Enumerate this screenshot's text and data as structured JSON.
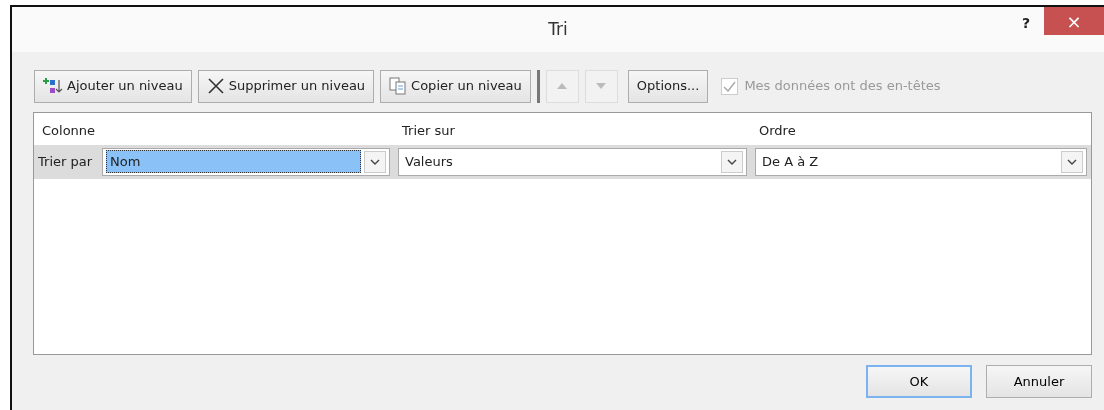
{
  "window": {
    "title": "Tri",
    "help": "?",
    "close": "×"
  },
  "toolbar": {
    "buttons": [
      {
        "kind": "add",
        "label": "Ajouter un niveau"
      },
      {
        "kind": "delete",
        "label": "Supprimer un niveau"
      },
      {
        "kind": "copy",
        "label": "Copier un niveau"
      }
    ],
    "move_up": {
      "disabled": true
    },
    "move_down": {
      "disabled": true
    },
    "options": "Options...",
    "headers_checkbox": {
      "label": "Mes données ont des en-têtes",
      "checked": true,
      "disabled": true
    }
  },
  "table": {
    "columns": [
      "Colonne",
      "Trier sur",
      "Ordre"
    ],
    "rows": [
      {
        "label": "Trier par",
        "selected": true,
        "column": {
          "value": "Nom",
          "highlighted": true
        },
        "sort_on": "Valeurs",
        "order": "De A à Z"
      }
    ]
  },
  "footer": {
    "buttons": [
      {
        "label": "OK",
        "default": true
      },
      {
        "label": "Annuler",
        "default": false
      }
    ]
  }
}
